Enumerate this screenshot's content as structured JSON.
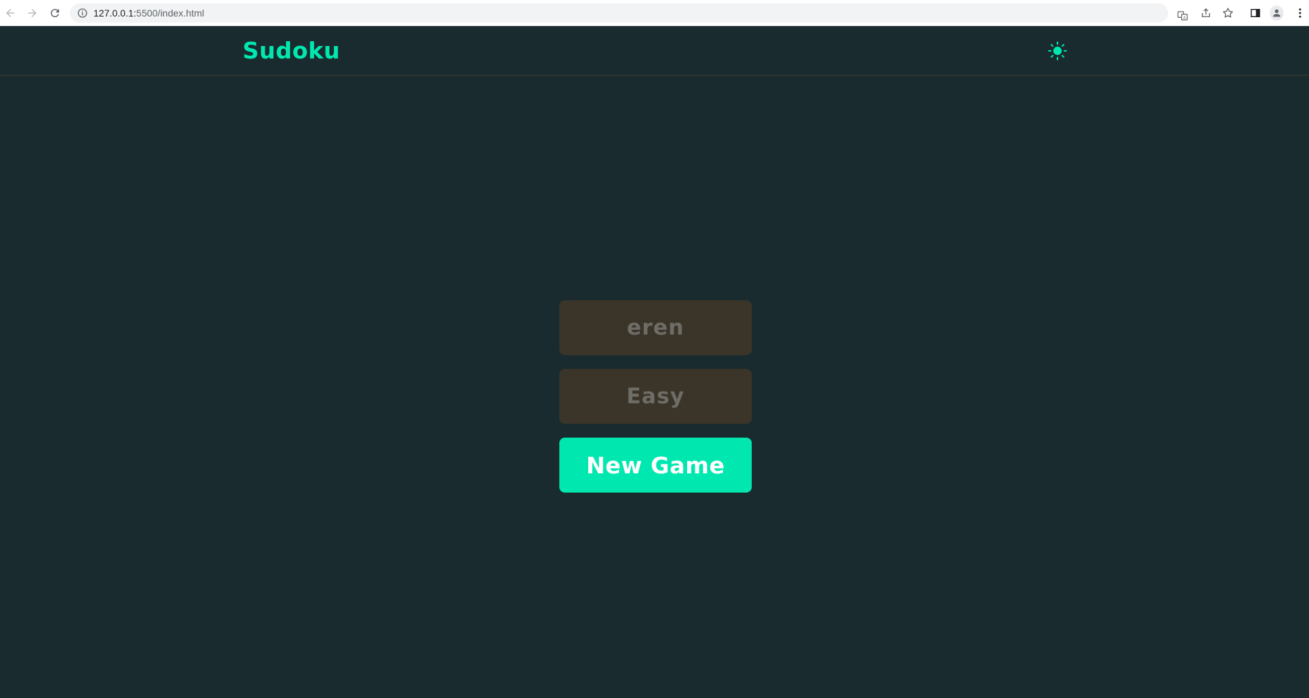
{
  "browser": {
    "url_host": "127.0.0.1:",
    "url_path": "5500/index.html"
  },
  "header": {
    "logo": "Sudoku",
    "theme_icon": "sun-icon"
  },
  "form": {
    "player_name": "eren",
    "difficulty": "Easy",
    "new_game_label": "New Game"
  },
  "colors": {
    "background": "#1a2b2f",
    "accent": "#00e8b0",
    "field_bg": "#3a3528",
    "field_text": "#6e6c66"
  }
}
